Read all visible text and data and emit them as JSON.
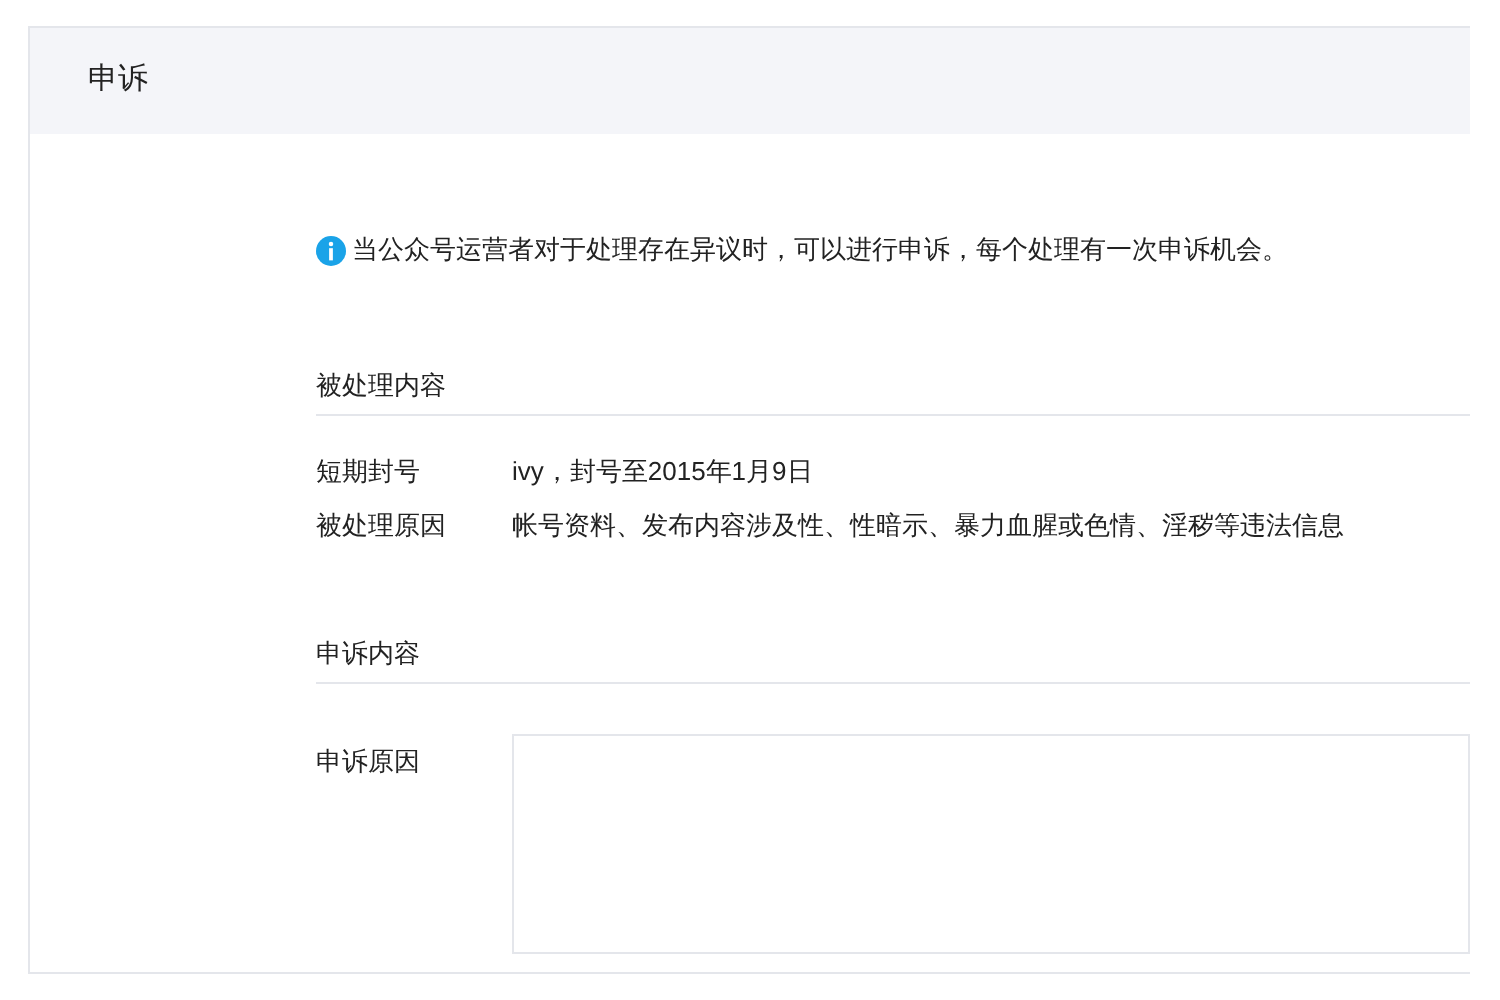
{
  "panel": {
    "title": "申诉"
  },
  "notice": "当公众号运营者对于处理存在异议时，可以进行申诉，每个处理有一次申诉机会。",
  "sections": [
    {
      "heading": "被处理内容",
      "rows": [
        {
          "kind": "text",
          "label": "短期封号",
          "value": "ivy，封号至2015年1月9日"
        },
        {
          "kind": "text",
          "label": "被处理原因",
          "value": "帐号资料、发布内容涉及性、性暗示、暴力血腥或色情、淫秽等违法信息"
        }
      ]
    },
    {
      "heading": "申诉内容",
      "rows": [
        {
          "kind": "textarea",
          "label": "申诉原因"
        }
      ]
    }
  ]
}
